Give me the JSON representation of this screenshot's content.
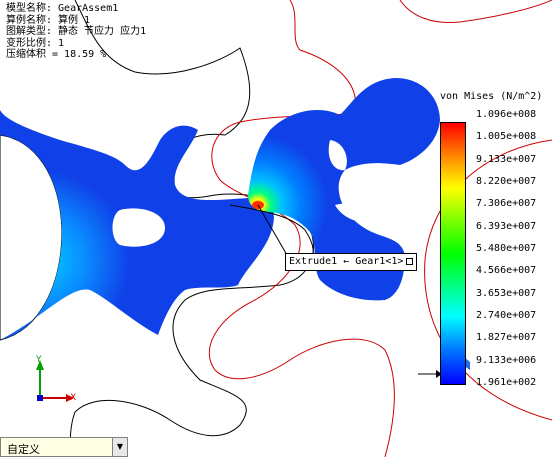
{
  "study_info": {
    "model_name": "模型名称: GearAssem1",
    "study_name": "算例名称: 算例 1",
    "plot_type": "图解类型: 静态 节应力 应力1",
    "deformation_scale": "变形比例: 1",
    "compression_volume": "压缩体积 = 18.59 %"
  },
  "legend": {
    "title": "von Mises (N/m^2)",
    "ticks": [
      "1.096e+008",
      "1.005e+008",
      "9.133e+007",
      "8.220e+007",
      "7.306e+007",
      "6.393e+007",
      "5.480e+007",
      "4.566e+007",
      "3.653e+007",
      "2.740e+007",
      "1.827e+007",
      "9.133e+006",
      "1.961e+002"
    ],
    "colors": [
      "#ff0000",
      "#ff8000",
      "#ffff00",
      "#80ff00",
      "#00ff00",
      "#00ff80",
      "#00ffff",
      "#0080ff",
      "#0000ff"
    ]
  },
  "callout": {
    "text": "Extrude1 ← Gear1<1>"
  },
  "triad": {
    "x_label": "X",
    "y_label": "Y"
  },
  "view_selector": {
    "value": "自定义"
  },
  "colors": {
    "gear_outline": "#cc0000",
    "stress_base": "#1040e8"
  }
}
